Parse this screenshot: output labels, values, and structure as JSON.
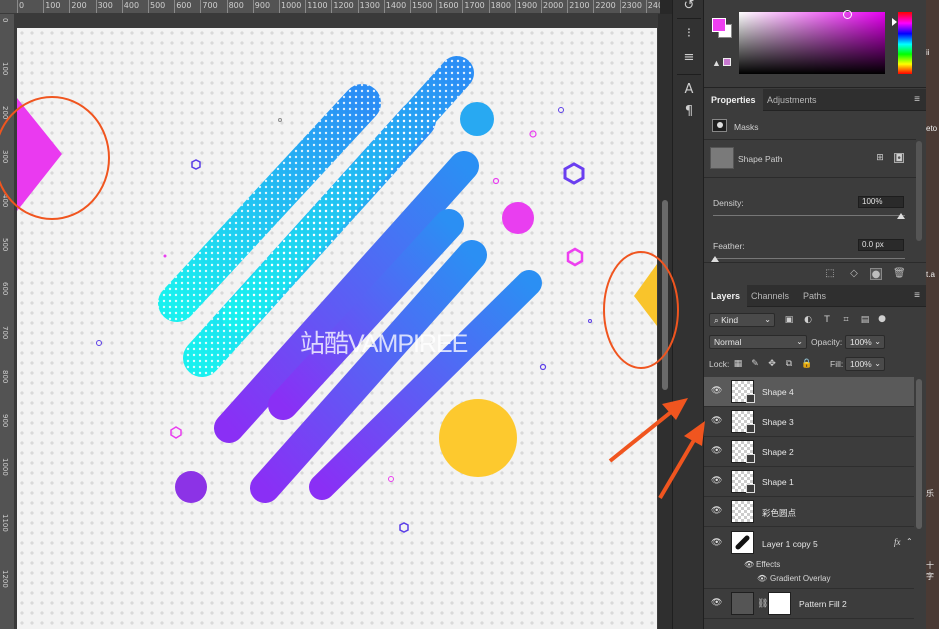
{
  "ruler": {
    "top_labels": [
      "0",
      "100",
      "200",
      "300",
      "400",
      "500",
      "600",
      "700",
      "800",
      "900",
      "1000",
      "1100",
      "1200",
      "1300",
      "1400",
      "1500",
      "1600",
      "1700",
      "1800",
      "1900",
      "2000",
      "2100",
      "2200",
      "2300",
      "240"
    ]
  },
  "canvas": {
    "watermark": "站酷VAMPIREE"
  },
  "colors": {
    "foreground": "#ee3ff0",
    "background": "#ffffff",
    "annotation": "#f0551f"
  },
  "properties_panel": {
    "tabs": [
      {
        "label": "Properties",
        "active": true
      },
      {
        "label": "Adjustments",
        "active": false
      }
    ],
    "masks_label": "Masks",
    "shape_path_label": "Shape Path",
    "density_label": "Density:",
    "density_value": "100%",
    "feather_label": "Feather:",
    "feather_value": "0.0 px"
  },
  "layers_panel": {
    "tabs": [
      {
        "label": "Layers",
        "active": true
      },
      {
        "label": "Channels",
        "active": false
      },
      {
        "label": "Paths",
        "active": false
      }
    ],
    "filter_kind": "Kind",
    "blend_mode": "Normal",
    "opacity_label": "Opacity:",
    "opacity_value": "100%",
    "lock_label": "Lock:",
    "fill_label": "Fill:",
    "fill_value": "100%",
    "layers": [
      {
        "name": "Shape 4",
        "selected": true
      },
      {
        "name": "Shape 3",
        "selected": false
      },
      {
        "name": "Shape 2",
        "selected": false
      },
      {
        "name": "Shape 1",
        "selected": false
      },
      {
        "name": "彩色圆点",
        "selected": false
      },
      {
        "name": "Layer 1 copy 5",
        "selected": false,
        "fx": "fx"
      },
      {
        "name": "Pattern Fill 2",
        "selected": false
      }
    ],
    "effects_label": "Effects",
    "gradient_overlay_label": "Gradient Overlay"
  },
  "side_strip": {
    "texts": [
      "ii",
      "eto",
      "t.a",
      "乐",
      "十字"
    ]
  }
}
